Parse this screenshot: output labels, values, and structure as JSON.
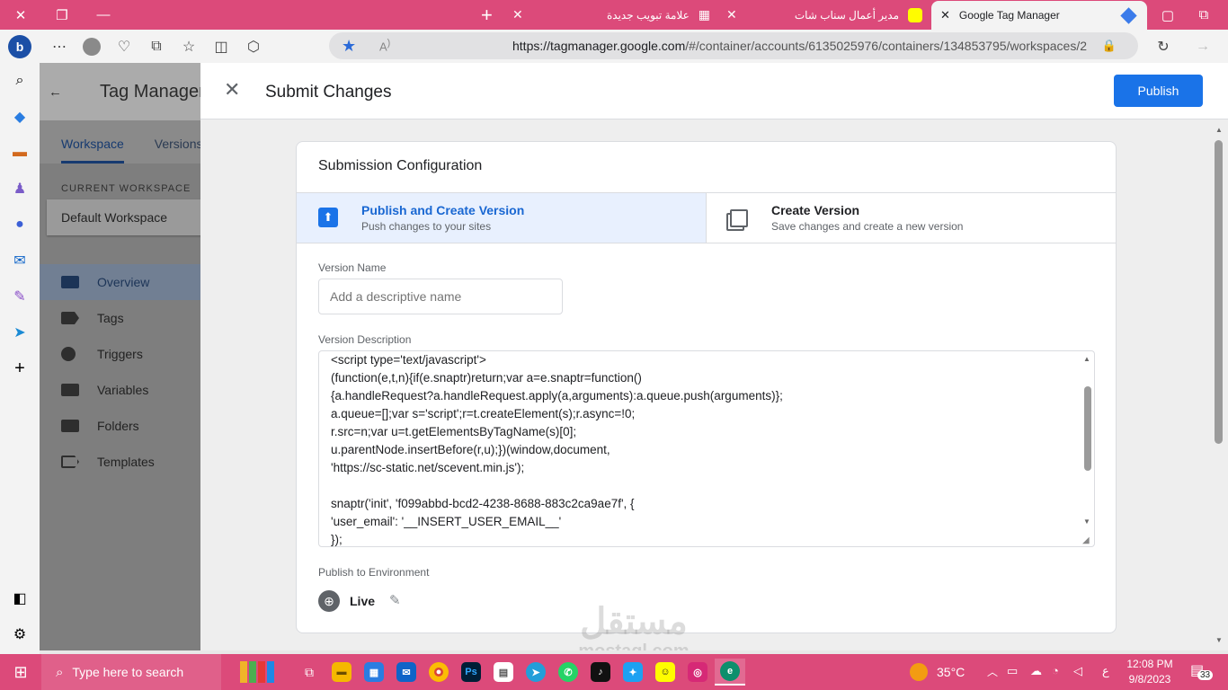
{
  "browser": {
    "tabs": [
      {
        "title": "علامة تبويب جديدة"
      },
      {
        "title": "مدير أعمال سناب شات"
      },
      {
        "title": "Google Tag Manager"
      }
    ],
    "url_host": "https://tagmanager.google.com",
    "url_rest": "/#/container/accounts/6135025976/containers/134853795/workspaces/2"
  },
  "gtm": {
    "app_name": "Tag Manager",
    "tabs": [
      "Workspace",
      "Versions"
    ],
    "current_workspace_label": "CURRENT WORKSPACE",
    "workspace_name": "Default Workspace",
    "nav": [
      "Overview",
      "Tags",
      "Triggers",
      "Variables",
      "Folders",
      "Templates"
    ]
  },
  "dialog": {
    "title": "Submit Changes",
    "publish_button": "Publish",
    "config_title": "Submission Configuration",
    "options": [
      {
        "title": "Publish and Create Version",
        "subtitle": "Push changes to your sites"
      },
      {
        "title": "Create Version",
        "subtitle": "Save changes and create a new version"
      }
    ],
    "version_name_label": "Version Name",
    "version_name_placeholder": "Add a descriptive name",
    "version_description_label": "Version Description",
    "version_description": "<script type='text/javascript'>\n(function(e,t,n){if(e.snaptr)return;var a=e.snaptr=function()\n{a.handleRequest?a.handleRequest.apply(a,arguments):a.queue.push(arguments)};\na.queue=[];var s='script';r=t.createElement(s);r.async=!0;\nr.src=n;var u=t.getElementsByTagName(s)[0];\nu.parentNode.insertBefore(r,u);})(window,document,\n'https://sc-static.net/scevent.min.js');\n\nsnaptr('init', 'f099abbd-bcd2-4238-8688-883c2ca9ae7f', {\n'user_email': '__INSERT_USER_EMAIL__'\n});",
    "environment_label": "Publish to Environment",
    "environment_name": "Live"
  },
  "watermark": {
    "line1": "مستقل",
    "line2": "mostaql.com"
  },
  "taskbar": {
    "search_placeholder": "Type here to search",
    "weather": "35°C",
    "time": "12:08 PM",
    "date": "9/8/2023",
    "notifications": "33",
    "lang": "ع"
  },
  "colors": {
    "accent": "#1a73e8",
    "browser_chrome": "#dc4a7a",
    "selected_option_bg": "#e8f0fe"
  }
}
